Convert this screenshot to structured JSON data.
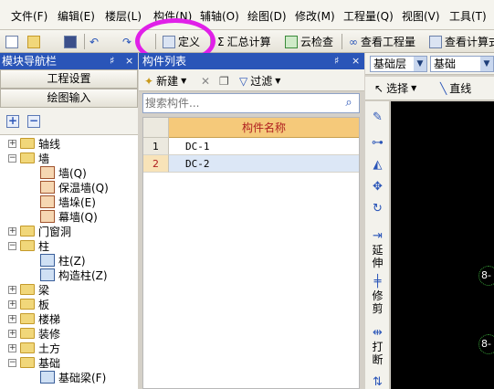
{
  "menu": [
    "文件(F)",
    "编辑(E)",
    "楼层(L)",
    "构件(N)",
    "辅轴(O)",
    "绘图(D)",
    "修改(M)",
    "工程量(Q)",
    "视图(V)",
    "工具(T)"
  ],
  "toolbar": {
    "define_label": "定义",
    "sum_label": "汇总计算",
    "cloud_check_label": "云检查",
    "view_qty_label": "查看工程量",
    "view_calc_label": "查看计算式"
  },
  "nav": {
    "title": "模块导航栏",
    "pin": "♯",
    "close": "×",
    "tab_project": "工程设置",
    "tab_draw": "绘图输入",
    "expand_all": "+",
    "collapse_all": "−"
  },
  "tree": [
    {
      "label": "轴线",
      "level": 0,
      "expander": "+",
      "icon": "folder-icon"
    },
    {
      "label": "墙",
      "level": 0,
      "expander": "−",
      "icon": "folder-open-icon"
    },
    {
      "label": "墙(Q)",
      "level": 1,
      "icon": "wall-icon"
    },
    {
      "label": "保温墙(Q)",
      "level": 1,
      "icon": "insulation-wall-icon"
    },
    {
      "label": "墙垛(E)",
      "level": 1,
      "icon": "wall-pier-icon"
    },
    {
      "label": "幕墙(Q)",
      "level": 1,
      "icon": "curtain-wall-icon"
    },
    {
      "label": "门窗洞",
      "level": 0,
      "expander": "+",
      "icon": "folder-icon"
    },
    {
      "label": "柱",
      "level": 0,
      "expander": "−",
      "icon": "folder-open-icon"
    },
    {
      "label": "柱(Z)",
      "level": 1,
      "icon": "column-icon"
    },
    {
      "label": "构造柱(Z)",
      "level": 1,
      "icon": "constructional-column-icon"
    },
    {
      "label": "梁",
      "level": 0,
      "expander": "+",
      "icon": "folder-icon"
    },
    {
      "label": "板",
      "level": 0,
      "expander": "+",
      "icon": "folder-icon"
    },
    {
      "label": "楼梯",
      "level": 0,
      "expander": "+",
      "icon": "folder-icon"
    },
    {
      "label": "装修",
      "level": 0,
      "expander": "+",
      "icon": "folder-icon"
    },
    {
      "label": "土方",
      "level": 0,
      "expander": "+",
      "icon": "folder-icon"
    },
    {
      "label": "基础",
      "level": 0,
      "expander": "−",
      "icon": "folder-open-icon"
    },
    {
      "label": "基础梁(F)",
      "level": 1,
      "icon": "foundation-beam-icon"
    }
  ],
  "component_panel": {
    "title": "构件列表",
    "pin": "♯",
    "close": "×",
    "new_label": "新建",
    "filter_label": "过滤",
    "search_placeholder": "搜索构件...",
    "column_header": "构件名称",
    "rows": [
      {
        "num": "1",
        "name": "DC-1",
        "selected": false
      },
      {
        "num": "2",
        "name": "DC-2",
        "selected": true
      }
    ]
  },
  "floor_bar": {
    "floor_selected": "基础层",
    "category_selected": "基础"
  },
  "draw_bar": {
    "select_label": "选择",
    "line_label": "直线"
  },
  "side_tools": {
    "extend_label": "延伸",
    "trim_label": "修剪",
    "break_label": "打断"
  },
  "canvas": {
    "axis_labels": [
      "8-",
      "8-"
    ]
  }
}
